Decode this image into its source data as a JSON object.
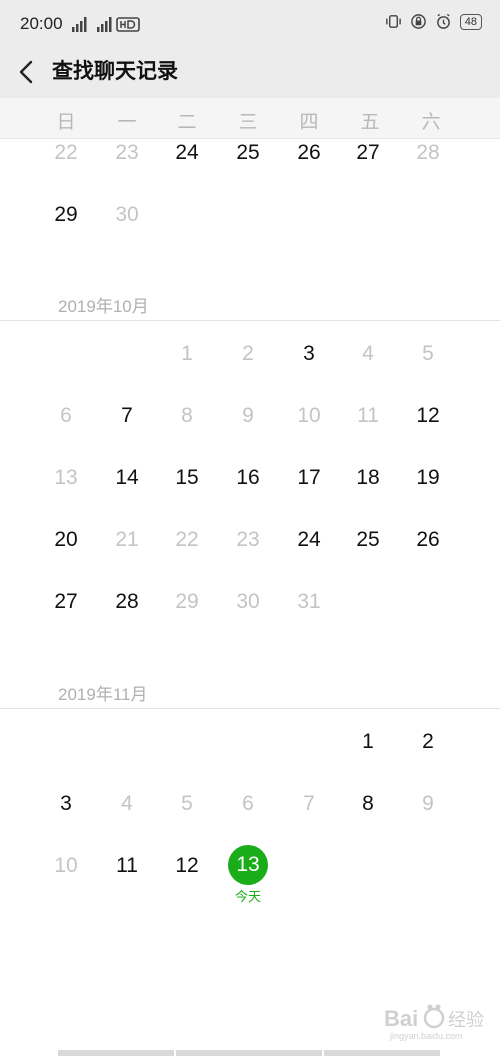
{
  "status_bar": {
    "time": "20:00",
    "battery": "48"
  },
  "header": {
    "title": "查找聊天记录"
  },
  "weekdays": [
    "日",
    "一",
    "二",
    "三",
    "四",
    "五",
    "六"
  ],
  "months": [
    {
      "label": ""
    },
    {
      "label": "2019年10月"
    },
    {
      "label": "2019年11月"
    }
  ],
  "today": {
    "day": "13",
    "label": "今天"
  },
  "watermark": {
    "text": "Bai 经验",
    "subtext": "jingyan.baidu.com"
  }
}
